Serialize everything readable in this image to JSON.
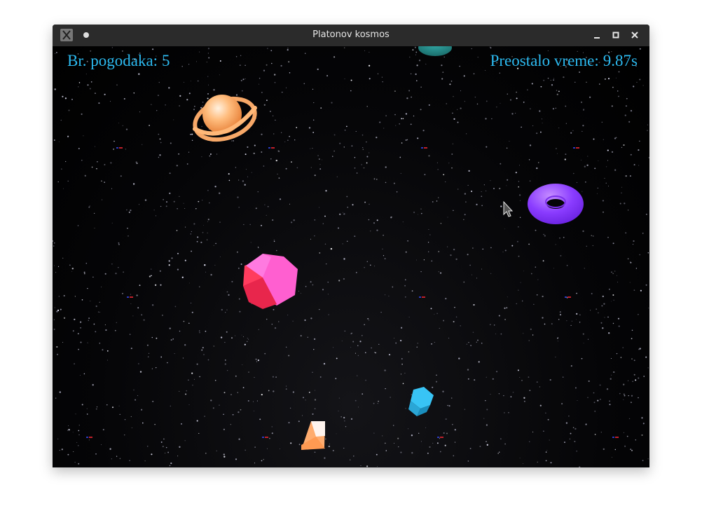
{
  "window": {
    "title": "Platonov kosmos"
  },
  "hud": {
    "hits_label": "Br. pogodaka:",
    "hits_value": "5",
    "time_label": "Preostalo vreme:",
    "time_value": "9.87s"
  },
  "icons": {
    "app": "x-app-icon",
    "minimize": "minimize-icon",
    "maximize": "maximize-icon",
    "close": "close-icon",
    "cursor": "mouse-pointer-icon"
  },
  "colors": {
    "hud_text": "#2cb9ef",
    "titlebar": "#2b2b2b",
    "planet": "#ffb070",
    "torus": "#8a3cff",
    "dodecahedron": "#ff5ad6",
    "cube": "#38c4f5",
    "octahedron": "#ffac6e"
  }
}
